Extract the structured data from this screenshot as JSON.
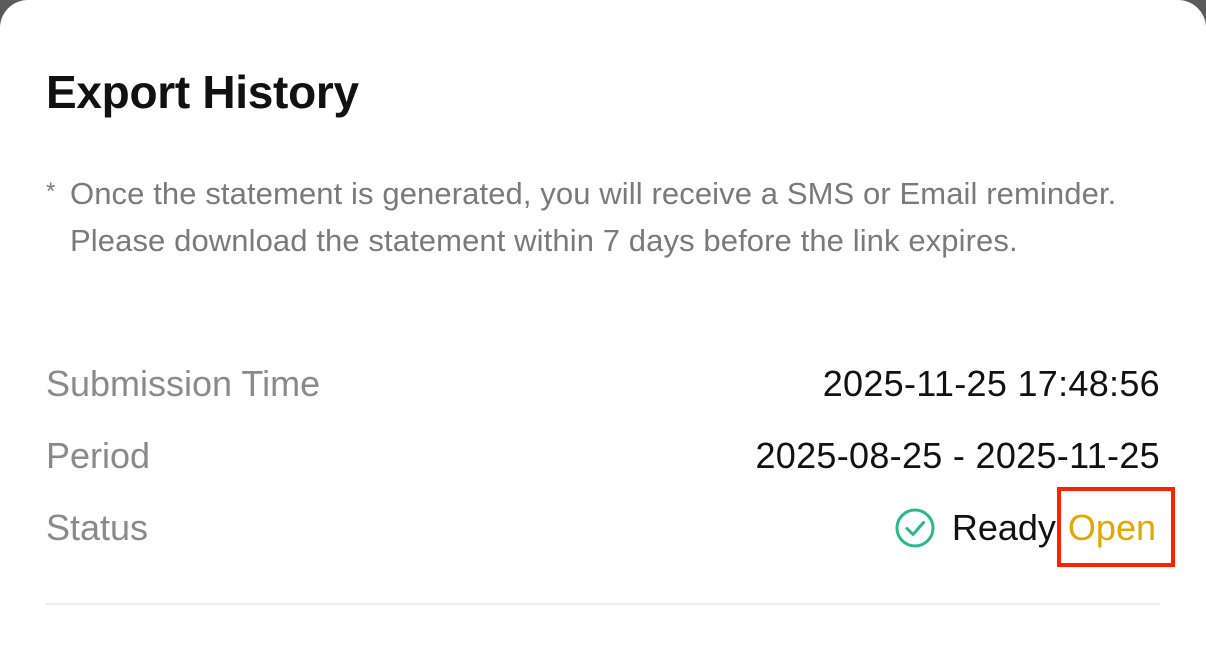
{
  "header": {
    "title": "Export History"
  },
  "notice": {
    "marker": "*",
    "text": "Once the statement is generated, you will receive a SMS or Email reminder. Please download the statement within 7 days before the link expires."
  },
  "record": {
    "submission_time": {
      "label": "Submission Time",
      "value": "2025-11-25 17:48:56"
    },
    "period": {
      "label": "Period",
      "value": "2025-08-25 - 2025-11-25"
    },
    "status": {
      "label": "Status",
      "value": "Ready",
      "icon": "check-circle-icon",
      "action_label": "Open"
    }
  },
  "colors": {
    "status_icon": "#2db889",
    "action": "#e0a800",
    "highlight": "#ff2200"
  }
}
